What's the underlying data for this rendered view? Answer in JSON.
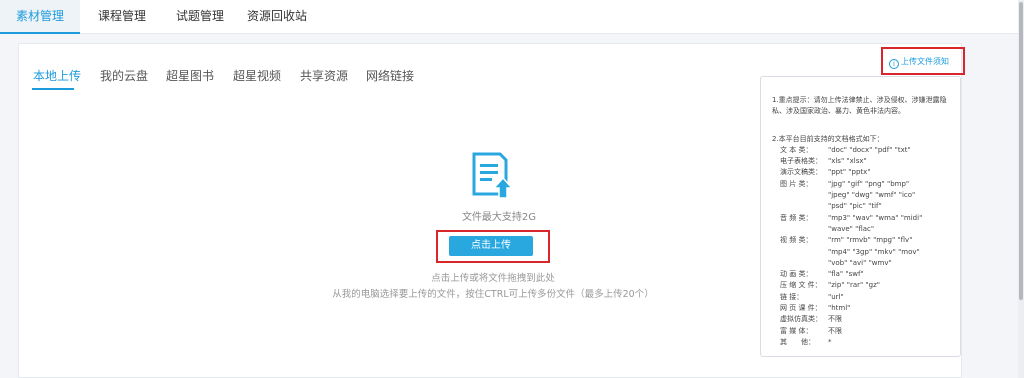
{
  "top_tabs": [
    {
      "label": "素材管理",
      "active": true
    },
    {
      "label": "课程管理",
      "active": false
    },
    {
      "label": "试题管理",
      "active": false
    },
    {
      "label": "资源回收站",
      "active": false
    }
  ],
  "sub_tabs": [
    {
      "label": "本地上传",
      "active": true
    },
    {
      "label": "我的云盘",
      "active": false
    },
    {
      "label": "超星图书",
      "active": false
    },
    {
      "label": "超星视频",
      "active": false
    },
    {
      "label": "共享资源",
      "active": false
    },
    {
      "label": "网络链接",
      "active": false
    }
  ],
  "upload": {
    "icon": "upload-file-icon",
    "max_size": "文件最大支持2G",
    "button_label": "点击上传",
    "drag_hint": "点击上传或将文件拖拽到此处",
    "select_hint": "从我的电脑选择要上传的文件，按住CTRL可上传多份文件（最多上传20个）"
  },
  "upload_notice_link": "上传文件须知",
  "info_panel": {
    "notice_1": "1.重点提示：请勿上传法律禁止、涉及侵权、涉嫌泄露隐私、涉及国家政治、暴力、黄色非法内容。",
    "notice_2": "2.本平台目前支持的文档格式如下：",
    "formats": [
      {
        "label": "文 本 类：",
        "values": [
          "\"doc\"  \"docx\"  \"pdf\"  \"txt\""
        ]
      },
      {
        "label": "电子表格类：",
        "values": [
          "\"xls\"  \"xlsx\""
        ]
      },
      {
        "label": "演示文稿类：",
        "values": [
          "\"ppt\"  \"pptx\""
        ]
      },
      {
        "label": "图 片 类：",
        "values": [
          "\"jpg\"  \"gif\"  \"png\"  \"bmp\"",
          "\"jpeg\"  \"dwg\"  \"wmf\"  \"ico\"",
          "\"psd\"  \"pic\"  \"tif\""
        ]
      },
      {
        "label": "音 频 类：",
        "values": [
          "\"mp3\"  \"wav\"  \"wma\"  \"midi\"",
          "\"wave\"  \"flac\""
        ]
      },
      {
        "label": "视 频 类：",
        "values": [
          "\"rm\"  \"rmvb\"  \"mpg\"  \"flv\"",
          "\"mp4\"  \"3gp\"  \"mkv\"  \"mov\"",
          "\"vob\"  \"avi\"  \"wmv\""
        ]
      },
      {
        "label": "动 画 类：",
        "values": [
          "\"fla\"  \"swf\""
        ]
      },
      {
        "label": "压 缩 文 件：",
        "values": [
          "\"zip\"  \"rar\"  \"gz\""
        ]
      },
      {
        "label": "链 接：",
        "values": [
          "\"url\""
        ]
      },
      {
        "label": "网 页 课 件：",
        "values": [
          "\"html\""
        ]
      },
      {
        "label": "虚拟仿真类：",
        "values": [
          "不限"
        ]
      },
      {
        "label": "富 媒 体：",
        "values": [
          "不限"
        ]
      },
      {
        "label": "其　　他：",
        "values": [
          "*"
        ]
      }
    ]
  },
  "colors": {
    "accent": "#1e9bdc",
    "button": "#29a8e0",
    "highlight_box": "#d9262b"
  }
}
